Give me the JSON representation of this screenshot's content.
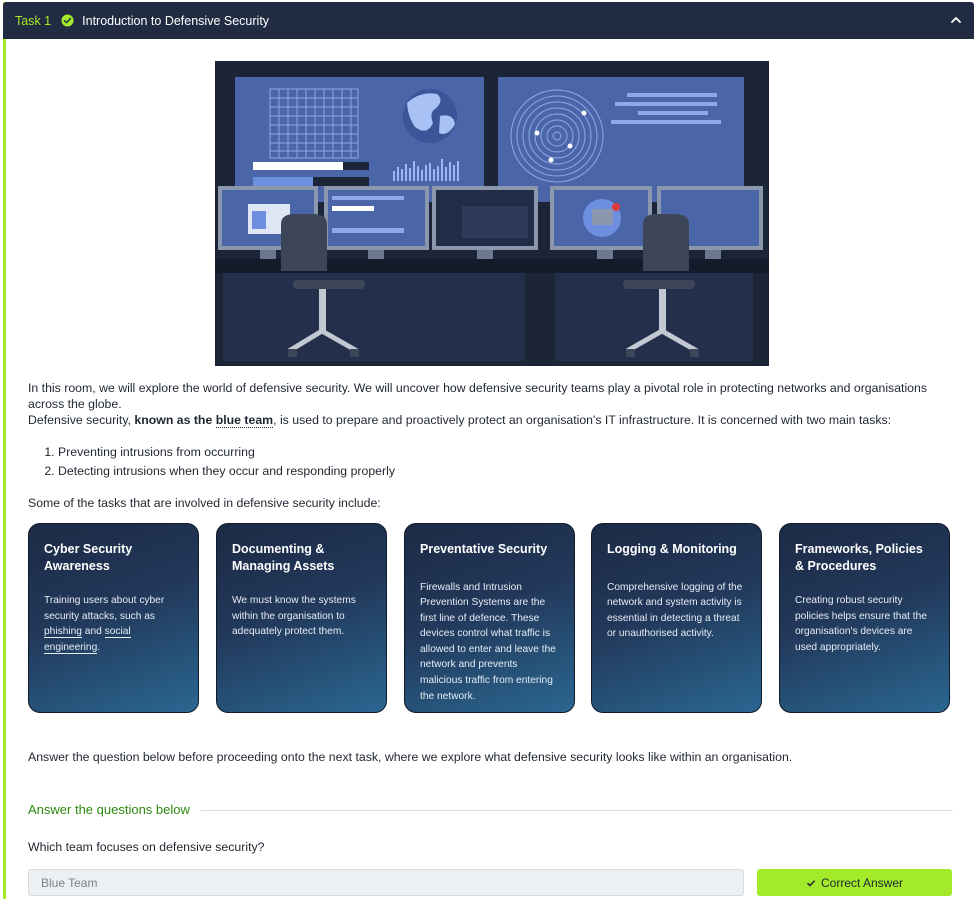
{
  "header": {
    "task_label": "Task 1",
    "title": "Introduction to Defensive Security"
  },
  "intro": "In this room, we will explore the world of defensive security. We will uncover how defensive security teams play a pivotal role in protecting networks and organisations across the globe.",
  "defensive": {
    "pre": "Defensive security, ",
    "bold_a": "known as the ",
    "bold_b": "blue team",
    "post": ", is used to prepare and proactively protect an organisation's IT infrastructure.  It is concerned with two main tasks:"
  },
  "main_tasks": [
    "Preventing intrusions from occurring",
    "Detecting intrusions when they occur and responding properly"
  ],
  "tasks_intro": "Some of the tasks that are involved in defensive security include:",
  "cards": [
    {
      "title": "Cyber Security Awareness",
      "desc_a": "Training users about cyber security attacks, such as ",
      "link1": "phishing",
      "mid": " and ",
      "link2": "social engineering",
      "end": "."
    },
    {
      "title": "Documenting & Managing Assets",
      "desc": "We must know the systems within the organisation to adequately protect them."
    },
    {
      "title": "Preventative Security",
      "desc": "Firewalls and Intrusion Prevention Systems are the first line of defence. These devices control what traffic is allowed to enter and leave the network and prevents malicious traffic from entering the network."
    },
    {
      "title": "Logging & Monitoring",
      "desc": "Comprehensive logging of the network and system activity is essential in detecting a threat or unauthorised activity."
    },
    {
      "title": "Frameworks, Policies & Procedures",
      "desc": "Creating robust security policies helps ensure that the organisation's devices are used appropriately."
    }
  ],
  "outro": "Answer the question below before proceeding onto the next task, where we explore what defensive security looks like within an organisation.",
  "answers": {
    "section_title": "Answer the questions below",
    "question": "Which team focuses on defensive security?",
    "answer_value": "Blue Team",
    "button_label": "Correct Answer"
  },
  "colors": {
    "header_bg": "#212c42",
    "accent": "#a3ea2a",
    "card_dark": "#1c2a45",
    "card_light": "#2a6791",
    "answers_title": "#2d8a0e"
  }
}
